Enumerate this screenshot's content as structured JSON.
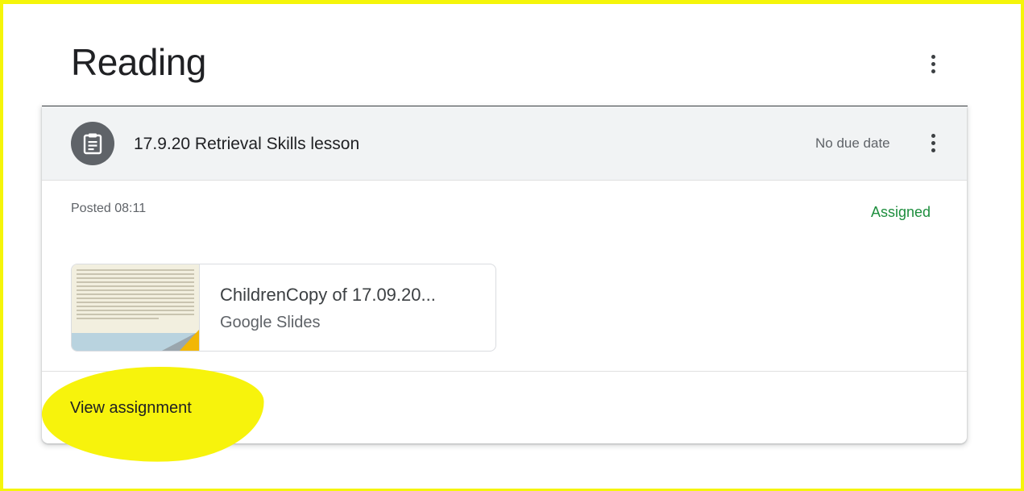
{
  "topic": {
    "title": "Reading",
    "more_icon": "more-vert-icon"
  },
  "assignment": {
    "icon": "assignment-icon",
    "title": "17.9.20 Retrieval Skills lesson",
    "due": "No due date",
    "more_icon": "more-vert-icon",
    "posted": "Posted 08:11",
    "status": "Assigned",
    "status_color": "#1e8e3e",
    "attachment": {
      "name": "ChildrenCopy of 17.09.20...",
      "type": "Google Slides"
    },
    "action_label": "View assignment"
  },
  "annotation": {
    "highlight_color": "#f7f30c",
    "frame_color": "#f5f50a"
  }
}
